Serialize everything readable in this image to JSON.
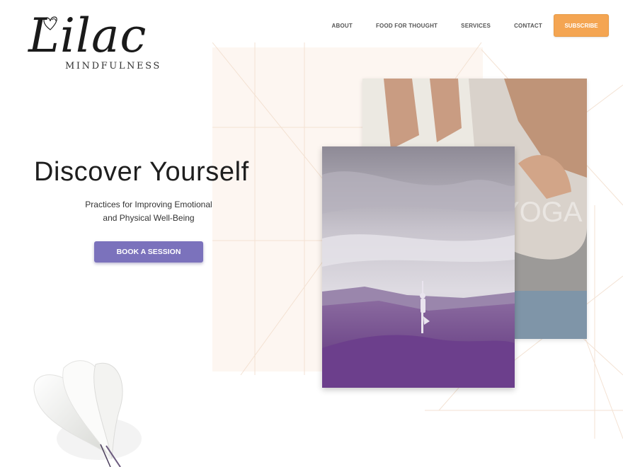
{
  "brand": {
    "script": "Lilac",
    "subtitle": "MINDFULNESS"
  },
  "nav": {
    "items": [
      "ABOUT",
      "FOOD FOR THOUGHT",
      "SERVICES",
      "CONTACT"
    ],
    "subscribe_label": "SUBSCRIBE"
  },
  "hero": {
    "title": "Discover Yourself",
    "subtitle_line1": "Practices for Improving Emotional",
    "subtitle_line2": "and Physical Well-Being",
    "cta_label": "BOOK A SESSION"
  },
  "photos": {
    "back_overlay_text": "YOGA"
  },
  "colors": {
    "accent_orange": "#f4a552",
    "accent_purple": "#7b72bc",
    "peach_panel": "#fdf6f1"
  },
  "icons": [
    "heart-outline-icon"
  ]
}
